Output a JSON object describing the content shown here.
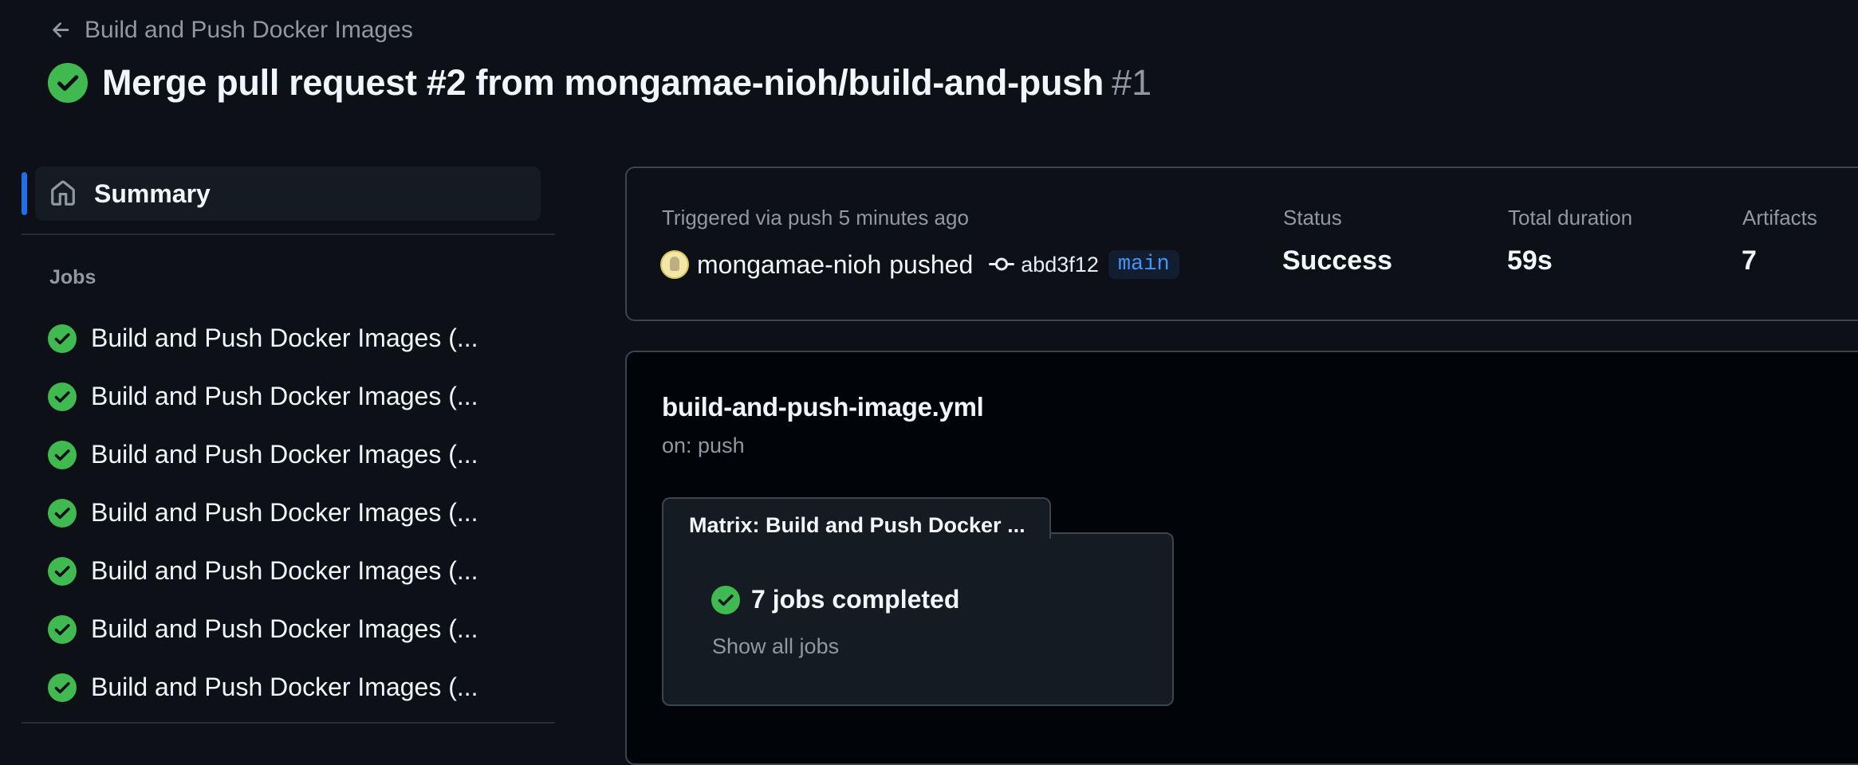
{
  "header": {
    "back_label": "Build and Push Docker Images",
    "title": "Merge pull request #2 from mongamae-nioh/build-and-push",
    "run_number": "#1"
  },
  "sidebar": {
    "summary_label": "Summary",
    "jobs_heading": "Jobs",
    "jobs": [
      {
        "label": "Build and Push Docker Images (...",
        "status": "success"
      },
      {
        "label": "Build and Push Docker Images (...",
        "status": "success"
      },
      {
        "label": "Build and Push Docker Images (...",
        "status": "success"
      },
      {
        "label": "Build and Push Docker Images (...",
        "status": "success"
      },
      {
        "label": "Build and Push Docker Images (...",
        "status": "success"
      },
      {
        "label": "Build and Push Docker Images (...",
        "status": "success"
      },
      {
        "label": "Build and Push Docker Images (...",
        "status": "success"
      }
    ]
  },
  "run_info": {
    "triggered_text": "Triggered via push 5 minutes ago",
    "actor": "mongamae-nioh",
    "action": "pushed",
    "commit_sha": "abd3f12",
    "branch": "main",
    "status_label": "Status",
    "status_value": "Success",
    "duration_label": "Total duration",
    "duration_value": "59s",
    "artifacts_label": "Artifacts",
    "artifacts_value": "7"
  },
  "workflow": {
    "file_name": "build-and-push-image.yml",
    "trigger": "on: push",
    "matrix_label": "Matrix: Build and Push Docker ...",
    "matrix_status": "7 jobs completed",
    "show_all_label": "Show all jobs"
  },
  "colors": {
    "background": "#0d1117",
    "success": "#3fb950",
    "accent": "#1f6feb",
    "link": "#4493f8"
  },
  "icons": {
    "back": "arrow-left-icon",
    "status": "check-circle-fill-icon",
    "summary": "home-icon",
    "commit": "git-commit-icon"
  }
}
